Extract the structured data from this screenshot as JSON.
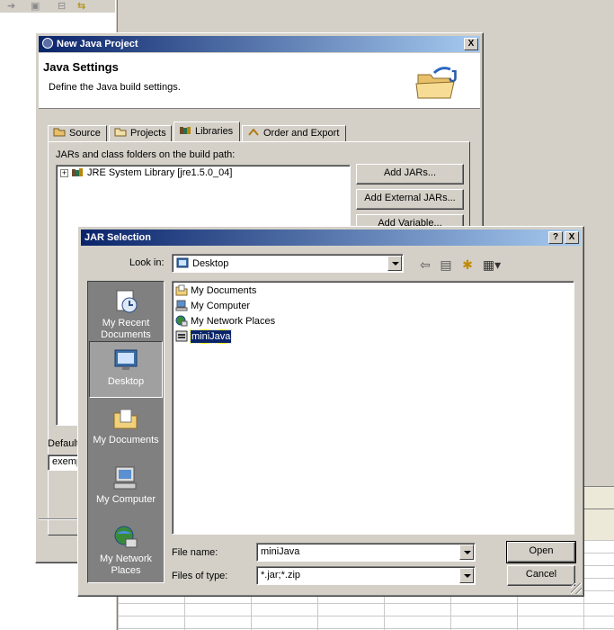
{
  "new_java_project": {
    "title": "New Java Project",
    "banner_heading": "Java Settings",
    "banner_description": "Define the Java build settings.",
    "tabs": [
      {
        "label": "Source",
        "icon": "source-folder-icon",
        "selected": false
      },
      {
        "label": "Projects",
        "icon": "projects-icon",
        "selected": false
      },
      {
        "label": "Libraries",
        "icon": "libraries-icon",
        "selected": true
      },
      {
        "label": "Order and Export",
        "icon": "order-export-icon",
        "selected": false
      }
    ],
    "build_path_label": "JARs and class folders on the build path:",
    "tree_items": [
      {
        "label": "JRE System Library [jre1.5.0_04]",
        "icon": "jar-library-icon"
      }
    ],
    "buttons": {
      "add_jars": "Add JARs...",
      "add_external_jars": "Add External JARs...",
      "add_variable": "Add Variable..."
    },
    "default_output_label": "Default",
    "default_output_value": "exemp",
    "close_label": "X"
  },
  "jar_selection": {
    "title": "JAR Selection",
    "help_label": "?",
    "close_label": "X",
    "look_in_label": "Look in:",
    "look_in_value": "Desktop",
    "places": [
      {
        "label": "My Recent Documents",
        "icon": "recent-documents-icon",
        "selected": false
      },
      {
        "label": "Desktop",
        "icon": "desktop-icon",
        "selected": true
      },
      {
        "label": "My Documents",
        "icon": "my-documents-icon",
        "selected": false
      },
      {
        "label": "My Computer",
        "icon": "my-computer-icon",
        "selected": false
      },
      {
        "label": "My Network Places",
        "icon": "network-places-icon",
        "selected": false
      }
    ],
    "files": [
      {
        "label": "My Documents",
        "icon": "my-documents-icon",
        "selected": false
      },
      {
        "label": "My Computer",
        "icon": "my-computer-icon",
        "selected": false
      },
      {
        "label": "My Network Places",
        "icon": "network-places-icon",
        "selected": false
      },
      {
        "label": "miniJava",
        "icon": "jar-file-icon",
        "selected": true
      }
    ],
    "file_name_label": "File name:",
    "file_name_value": "miniJava",
    "file_type_label": "Files of type:",
    "file_type_value": "*.jar;*.zip",
    "open_label": "Open",
    "cancel_label": "Cancel"
  },
  "colors": {
    "title_active": "#0a246a",
    "selection": "#0a246a",
    "face": "#d4d0c8",
    "places_bar": "#808080"
  }
}
